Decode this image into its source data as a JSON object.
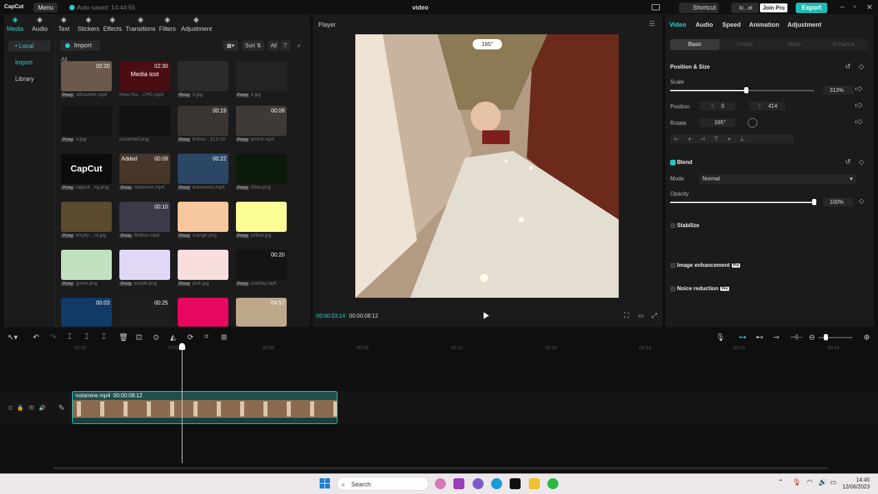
{
  "app": {
    "logo_text": "CapCut",
    "menu_label": "Menu",
    "autosave_text": "Auto saved: 14:44:55",
    "doc_title": "video"
  },
  "header": {
    "shortcut_label": "Shortcut",
    "user_name": "ki...el",
    "join_pro_label": "Join Pro",
    "export_label": "Export"
  },
  "media_tabs": [
    {
      "label": "Media",
      "icon": "media-icon"
    },
    {
      "label": "Audio",
      "icon": "audio-icon"
    },
    {
      "label": "Text",
      "icon": "text-icon"
    },
    {
      "label": "Stickers",
      "icon": "stickers-icon"
    },
    {
      "label": "Effects",
      "icon": "effects-icon"
    },
    {
      "label": "Transitions",
      "icon": "transitions-icon"
    },
    {
      "label": "Filters",
      "icon": "filters-icon"
    },
    {
      "label": "Adjustment",
      "icon": "adjustment-icon"
    }
  ],
  "sidebar": {
    "items": [
      "• Local",
      "Import",
      "Library"
    ]
  },
  "media_toolbar": {
    "import_label": "Import",
    "sort_label": "Sort",
    "all_label": "All",
    "all_header": "All"
  },
  "media_items": [
    {
      "name": "silhouette.mp4",
      "duration": "02:20",
      "proxy": true,
      "color": "#6b5a4c"
    },
    {
      "name": "How.You ...t PC.mp4",
      "duration": "02:30",
      "proxy": false,
      "color": "#4a0d12",
      "overlay": "Media lost"
    },
    {
      "name": "2.jpg",
      "duration": "",
      "proxy": true,
      "color": "#2b2b2b"
    },
    {
      "name": "3.jpg",
      "duration": "",
      "proxy": true,
      "color": "#232323"
    },
    {
      "name": "4.jpg",
      "duration": "",
      "proxy": true,
      "color": "#151515"
    },
    {
      "name": "unnamed.png",
      "duration": "",
      "proxy": false,
      "color": "#111111"
    },
    {
      "name": "Extrac...S10-10",
      "duration": "00:19",
      "proxy": true,
      "color": "#3a3532"
    },
    {
      "name": "amine.mp4",
      "duration": "00:09",
      "proxy": true,
      "color": "#3d3a38"
    },
    {
      "name": "capcut...ng.png",
      "duration": "",
      "proxy": true,
      "color": "#0c0c0c",
      "overlay": "CapCut"
    },
    {
      "name": "notamine.mp4",
      "duration": "00:09",
      "proxy": true,
      "color": "#47362a",
      "added": "Added"
    },
    {
      "name": "avemoves.mp4",
      "duration": "00:22",
      "proxy": true,
      "color": "#2c4766"
    },
    {
      "name": "Glow.png",
      "duration": "",
      "proxy": true,
      "color": "#0c1a0c"
    },
    {
      "name": "empty-...nt.jpg",
      "duration": "",
      "proxy": true,
      "color": "#5a4a2e"
    },
    {
      "name": "Roblox.mp4",
      "duration": "00:10",
      "proxy": true,
      "color": "#3b3a4a"
    },
    {
      "name": "orange.png",
      "duration": "",
      "proxy": true,
      "color": "#f7c79d"
    },
    {
      "name": "yellow.jpg",
      "duration": "",
      "proxy": true,
      "color": "#fdfd96"
    },
    {
      "name": "green.png",
      "duration": "",
      "proxy": true,
      "color": "#c1e1c1"
    },
    {
      "name": "purple.png",
      "duration": "",
      "proxy": true,
      "color": "#e0d8f5"
    },
    {
      "name": "pink.jpg",
      "duration": "",
      "proxy": true,
      "color": "#f8dedd"
    },
    {
      "name": "overlay.mp4",
      "duration": "00:20",
      "proxy": true,
      "color": "#141414"
    },
    {
      "name": "",
      "duration": "00:03",
      "proxy": false,
      "color": "#123a66"
    },
    {
      "name": "",
      "duration": "00:25",
      "proxy": false,
      "color": "#1e1e1e"
    },
    {
      "name": "",
      "duration": "",
      "proxy": false,
      "color": "#e8085f"
    },
    {
      "name": "",
      "duration": "04:57",
      "proxy": false,
      "color": "#bda88c"
    }
  ],
  "player": {
    "label": "Player",
    "rotate_badge": "165°",
    "current_time": "00:00:03:14",
    "total_time": "00:00:08:12"
  },
  "props": {
    "tabs": [
      "Video",
      "Audio",
      "Speed",
      "Animation",
      "Adjustment"
    ],
    "subtabs": [
      "Basic",
      "Colour",
      "Mask",
      "Enhance"
    ],
    "position_size": "Position & Size",
    "scale_label": "Scale",
    "scale_value": "313%",
    "scale_fraction": 0.6,
    "position_label": "Position",
    "x_label": "X",
    "x_value": "0",
    "y_label": "Y",
    "y_value": "414",
    "rotate_label": "Rotate",
    "rotate_value": "165°",
    "blend": "Blend",
    "mode_label": "Mode",
    "mode_value": "Normal",
    "opacity_label": "Opacity",
    "opacity_value": "100%",
    "opacity_fraction": 1.0,
    "stabilize": "Stabilize",
    "image_enhancement": "Image enhancement",
    "noise_reduction": "Noice reduction",
    "pro_badge": "Pro"
  },
  "timeline": {
    "ruler": [
      "00:00",
      "00:03",
      "00:06",
      "00:09",
      "00:12",
      "00:15",
      "00:18",
      "00:21",
      "00:24"
    ],
    "clip_name": "notamine.mp4",
    "clip_duration": "00:00:08:12"
  },
  "taskbar": {
    "search_placeholder": "Search",
    "time": "14:45",
    "date": "12/06/2023"
  },
  "colors": {
    "accent": "#27c7c2",
    "panel": "#1b1b1c"
  }
}
